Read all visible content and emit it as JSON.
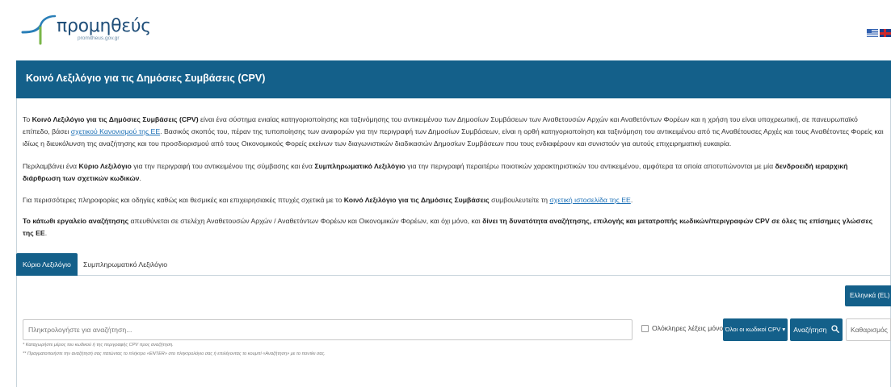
{
  "header": {
    "logo_text": "προμηθεύς",
    "logo_subtitle": "promitheus.gov.gr",
    "flags": [
      "greek-flag-icon",
      "uk-flag-icon"
    ]
  },
  "title_bar": {
    "title": "Κοινό Λεξιλόγιο για τις Δημόσιες Συμβάσεις (CPV)"
  },
  "intro": {
    "p1_a": "Το ",
    "p1_b": "Κοινό Λεξιλόγιο για τις Δημόσιες Συμβάσεις (CPV)",
    "p1_c": " είναι ένα σύστημα ενιαίας κατηγοριοποίησης και ταξινόμησης του αντικειμένου των Δημοσίων Συμβάσεων των Αναθετουσών Αρχών και Αναθετόντων Φορέων και η χρήση του είναι υποχρεωτική, σε πανευρωπαϊκό επίπεδο, βάσει ",
    "p1_link": "σχετικού Κανονισμού της ΕΕ",
    "p1_d": ". Βασικός σκοπός του, πέραν της τυποποίησης των αναφορών για την περιγραφή των Δημοσίων Συμβάσεων, είναι η ορθή κατηγοριοποίηση και ταξινόμηση του αντικειμένου από τις Αναθέτουσες Αρχές και τους Αναθέτοντες Φορείς και ιδίως η διευκόλυνση της αναζήτησης και του προσδιορισμού από τους Οικονομικούς Φορείς εκείνων των διαγωνιστικών διαδικασιών Δημοσίων Συμβάσεων που τους ενδιαφέρουν και συνιστούν για αυτούς επιχειρηματική ευκαιρία.",
    "p2_a": "Περιλαμβάνει ένα ",
    "p2_b": "Κύριο Λεξιλόγιο",
    "p2_c": " για την περιγραφή του αντικειμένου της σύμβασης και ένα ",
    "p2_d": "Συμπληρωματικό Λεξιλόγιο",
    "p2_e": " για την περιγραφή περαιτέρω ποιοτικών χαρακτηριστικών του αντικειμένου, αμφότερα τα οποία αποτυπώνονται με μία ",
    "p2_f": "δενδροειδή ιεραρχική διάρθρωση των σχετικών κωδικών",
    "p2_g": ".",
    "p3_a": "Για περισσότερες πληροφορίες και οδηγίες καθώς και θεσμικές και επιχειρησιακές πτυχές σχετικά με το ",
    "p3_b": "Κοινό Λεξιλόγιο για τις Δημόσιες Συμβάσεις",
    "p3_c": " συμβουλευτείτε τη ",
    "p3_link": "σχετική ιστοσελίδα της ΕΕ",
    "p3_d": ".",
    "p4_a": "Το κάτωθι εργαλείο αναζήτησης",
    "p4_b": " απευθύνεται σε στελέχη Αναθετουσών Αρχών / Αναθετόντων Φορέων και Οικονομικών Φορέων, και όχι μόνο, και ",
    "p4_c": "δίνει τη δυνατότητα αναζήτησης, επιλογής και μετατροπής κωδικών/περιγραφών CPV σε όλες τις επίσημες γλώσσες της ΕΕ",
    "p4_d": "."
  },
  "tabs": [
    {
      "label": "Κύριο Λεξιλόγιο",
      "active": true
    },
    {
      "label": "Συμπληρωματικό Λεξιλόγιο",
      "active": false
    }
  ],
  "search": {
    "language_label": "Ελληνικά (EL) ▾",
    "placeholder": "Πληκτρολογήστε για αναζήτηση...",
    "whole_words_label": "Ολόκληρες λέξεις μόνο",
    "whole_words_checked": false,
    "codes_filter_label": "Όλοι οι κωδικοί CPV ▾",
    "search_button_label": "Αναζήτηση",
    "clear_button_label": "Καθαρισμός",
    "hint1": "* Καταχωρήστε μέρος του κωδικού ή της περιγραφής CPV προς αναζήτηση.",
    "hint2": "** Πραγματοποιήστε την αναζήτησή σας πατώντας το πλήκτρο «ENTER» στο πληκτρολόγιο σας ή επιλέγοντας το κουμπί «Αναζήτηση» με το ποντίκι σας."
  },
  "colors": {
    "primary": "#14608a",
    "link": "#1b6fb5",
    "logo": "#1f4e79"
  }
}
